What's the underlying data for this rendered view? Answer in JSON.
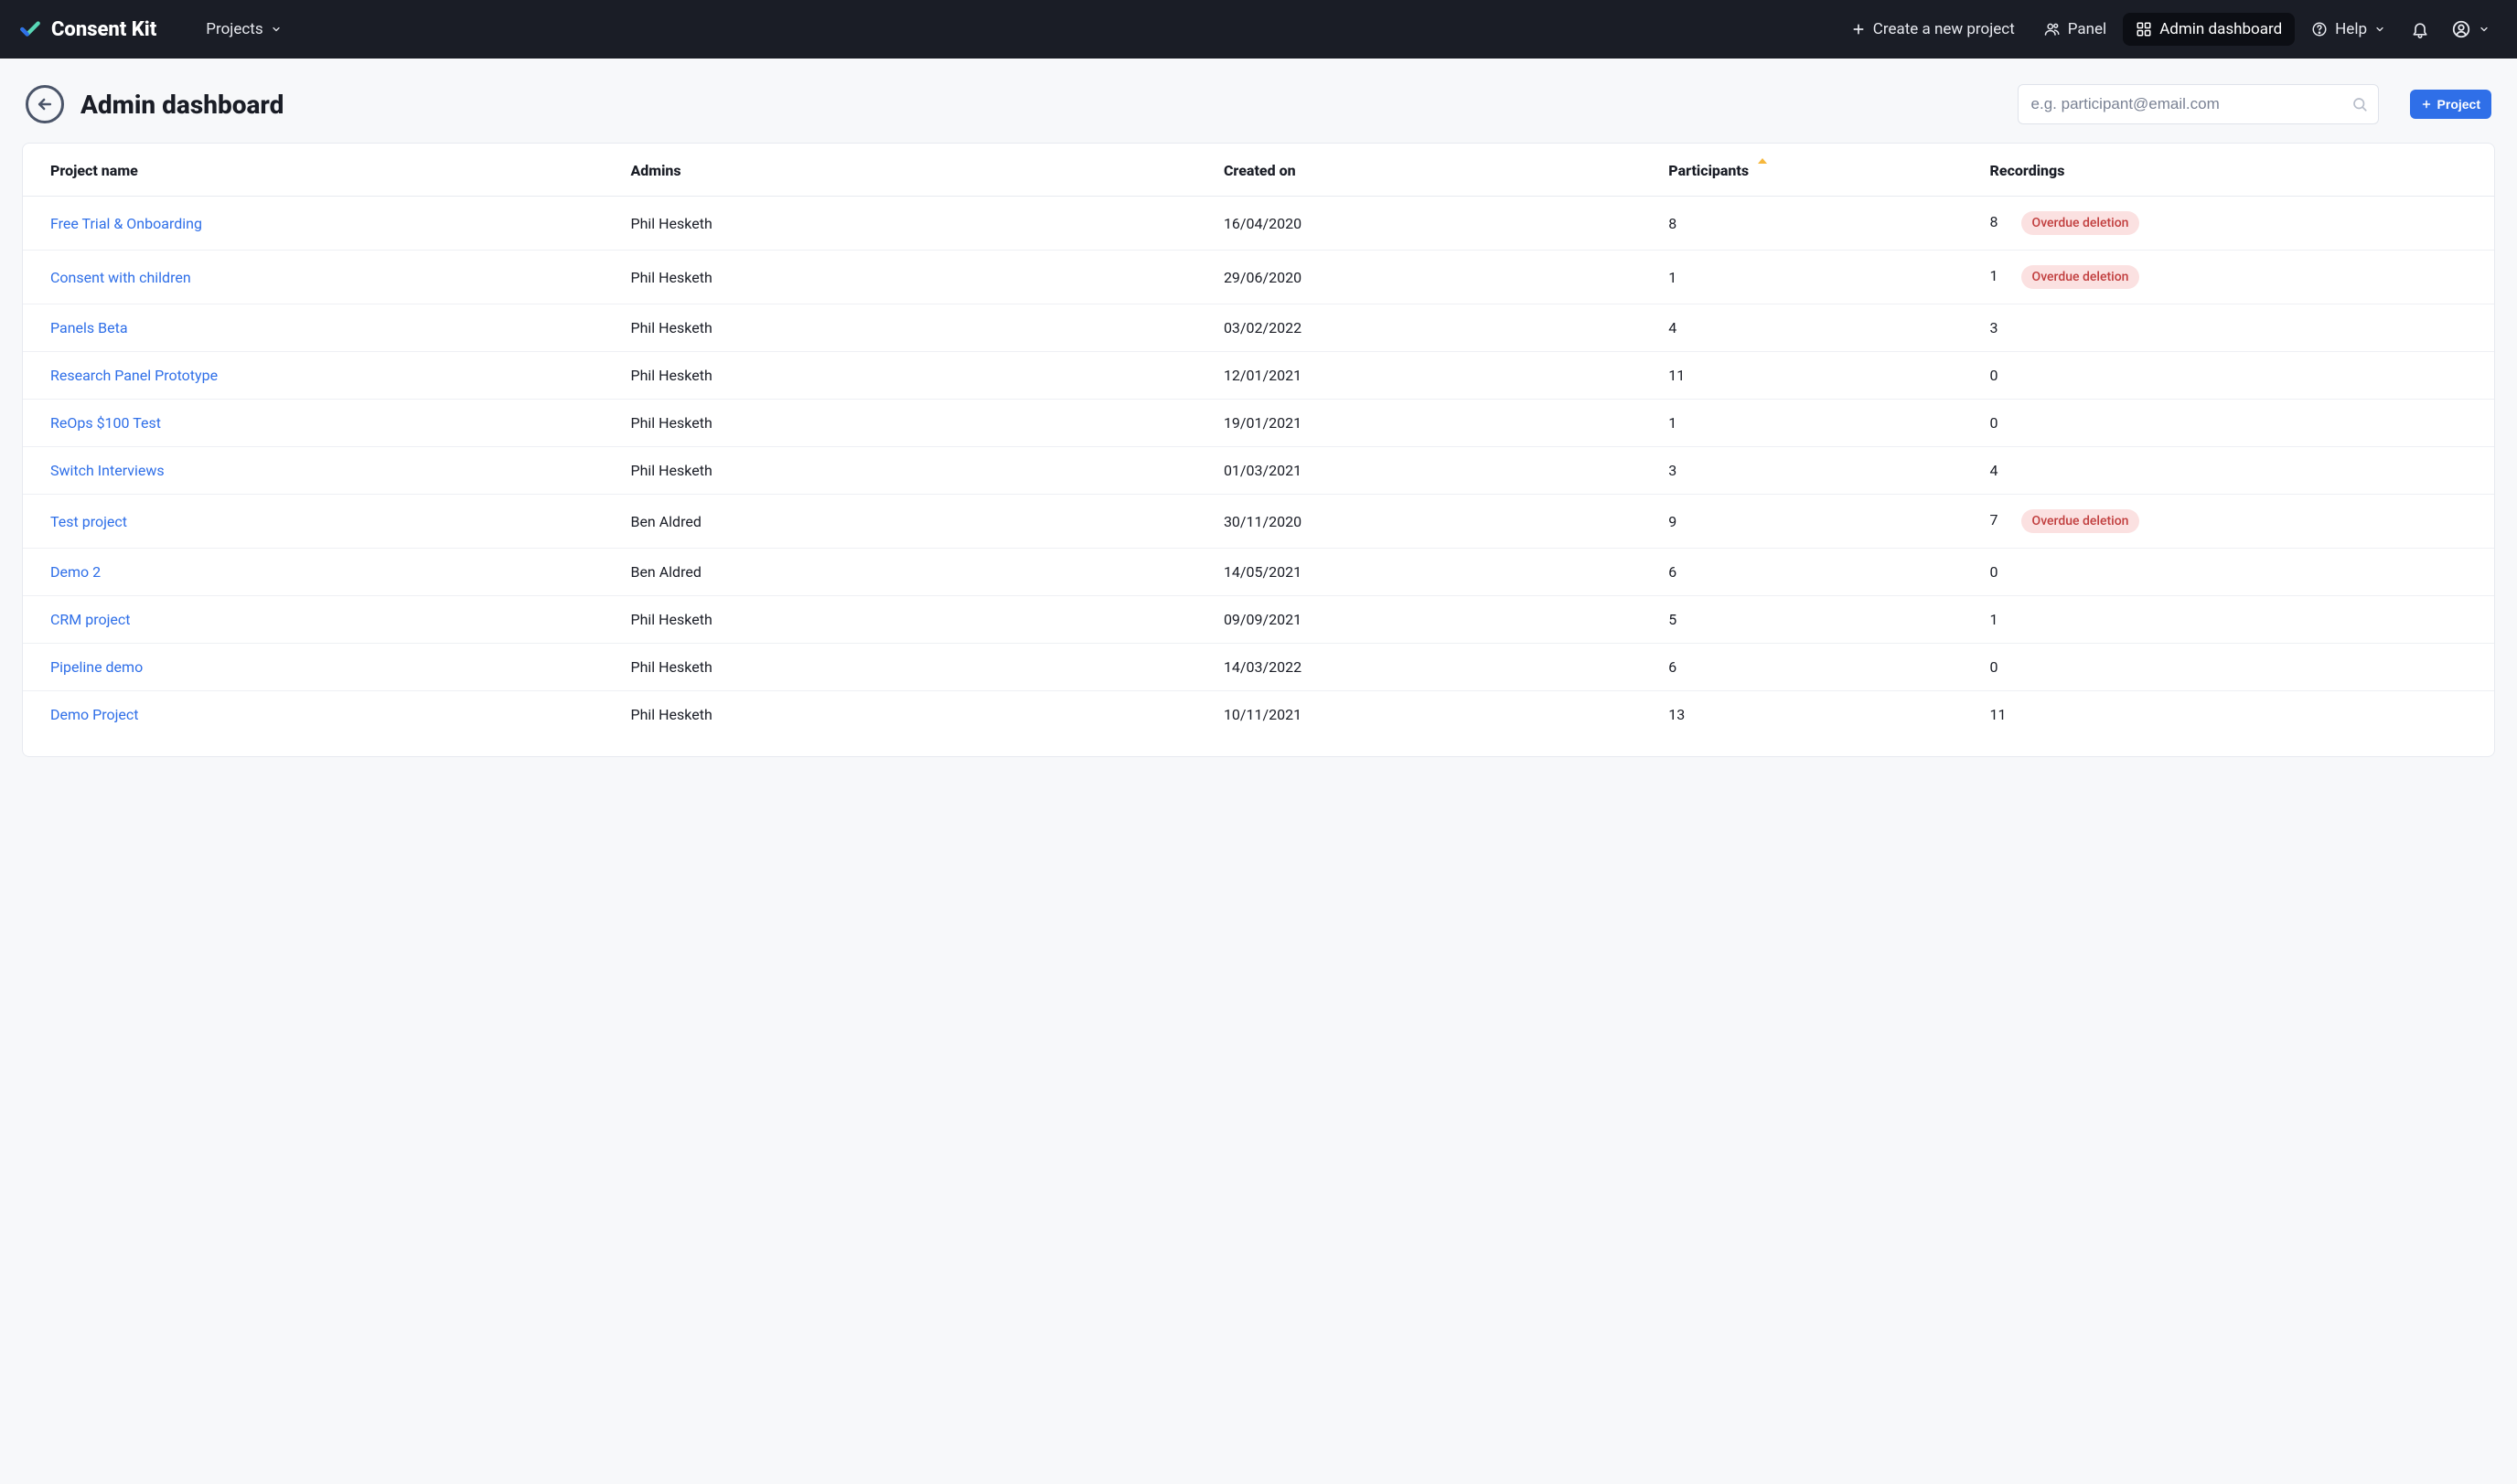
{
  "brand": {
    "name": "Consent Kit"
  },
  "nav": {
    "projects": "Projects",
    "create": "Create a new project",
    "panel": "Panel",
    "admin": "Admin dashboard",
    "help": "Help"
  },
  "page": {
    "title": "Admin dashboard",
    "search_placeholder": "e.g. participant@email.com",
    "add_project": "Project"
  },
  "table": {
    "headers": {
      "name": "Project name",
      "admins": "Admins",
      "created": "Created on",
      "participants": "Participants",
      "recordings": "Recordings"
    },
    "overdue_label": "Overdue deletion",
    "rows": [
      {
        "name": "Free Trial & Onboarding",
        "admin": "Phil Hesketh",
        "created": "16/04/2020",
        "participants": "8",
        "recordings": "8",
        "overdue": true
      },
      {
        "name": "Consent with children",
        "admin": "Phil Hesketh",
        "created": "29/06/2020",
        "participants": "1",
        "recordings": "1",
        "overdue": true
      },
      {
        "name": "Panels Beta",
        "admin": "Phil Hesketh",
        "created": "03/02/2022",
        "participants": "4",
        "recordings": "3",
        "overdue": false
      },
      {
        "name": "Research Panel Prototype",
        "admin": "Phil Hesketh",
        "created": "12/01/2021",
        "participants": "11",
        "recordings": "0",
        "overdue": false
      },
      {
        "name": "ReOps $100 Test",
        "admin": "Phil Hesketh",
        "created": "19/01/2021",
        "participants": "1",
        "recordings": "0",
        "overdue": false
      },
      {
        "name": "Switch Interviews",
        "admin": "Phil Hesketh",
        "created": "01/03/2021",
        "participants": "3",
        "recordings": "4",
        "overdue": false
      },
      {
        "name": "Test project",
        "admin": "Ben Aldred",
        "created": "30/11/2020",
        "participants": "9",
        "recordings": "7",
        "overdue": true
      },
      {
        "name": "Demo 2",
        "admin": "Ben Aldred",
        "created": "14/05/2021",
        "participants": "6",
        "recordings": "0",
        "overdue": false
      },
      {
        "name": "CRM project",
        "admin": "Phil Hesketh",
        "created": "09/09/2021",
        "participants": "5",
        "recordings": "1",
        "overdue": false
      },
      {
        "name": "Pipeline demo",
        "admin": "Phil Hesketh",
        "created": "14/03/2022",
        "participants": "6",
        "recordings": "0",
        "overdue": false
      },
      {
        "name": "Demo Project",
        "admin": "Phil Hesketh",
        "created": "10/11/2021",
        "participants": "13",
        "recordings": "11",
        "overdue": false
      }
    ]
  }
}
